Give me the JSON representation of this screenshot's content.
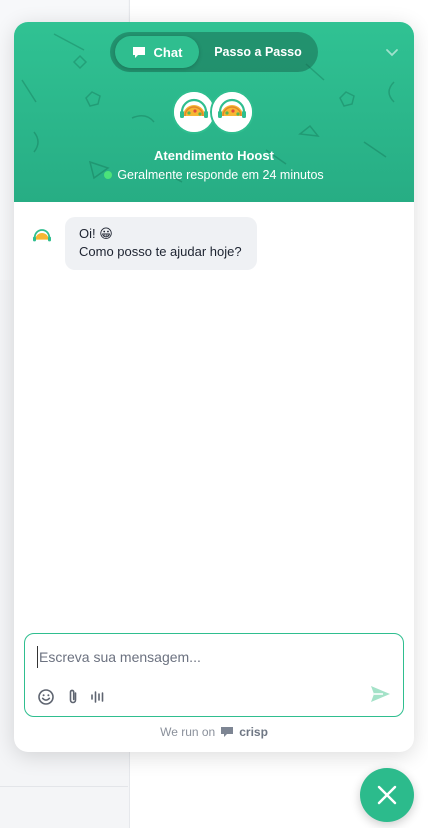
{
  "header": {
    "tabs": [
      {
        "label": "Chat",
        "active": true,
        "icon": "chat-bubble-icon"
      },
      {
        "label": "Passo a Passo",
        "active": false
      }
    ],
    "team_name": "Atendimento Hoost",
    "availability": "Geralmente responde em 24 minutos",
    "availability_color": "#4be37a"
  },
  "messages": [
    {
      "from": "operator",
      "lines": [
        "Oi! 😀",
        "Como posso te ajudar hoje?"
      ]
    }
  ],
  "composer": {
    "placeholder": "Escreva sua mensagem...",
    "tools": [
      "emoji-icon",
      "attach-icon",
      "audio-icon"
    ],
    "send_icon": "send-icon"
  },
  "powered_by": {
    "prefix": "We run on",
    "brand": "crisp"
  },
  "colors": {
    "accent": "#2fbe8f",
    "header_gradient_top": "#30c293",
    "header_gradient_bottom": "#27ad84",
    "bubble": "#eff1f4"
  }
}
